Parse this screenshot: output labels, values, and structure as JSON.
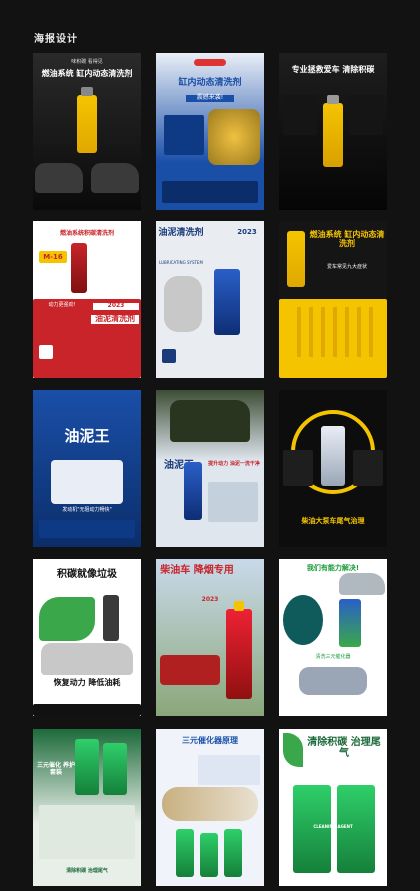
{
  "section": {
    "heading": "海报设计"
  },
  "posters": [
    {
      "title": "燃油系统 缸内动态清洗剂",
      "subtitle": "味积碳 看得见"
    },
    {
      "title": "缸内动态清洗剂",
      "subtitle": "震撼来袭!"
    },
    {
      "title": "专业拯救爱车 清除积碳",
      "subtitle": ""
    },
    {
      "title": "燃油系统积碳清洗剂",
      "subtitle": "油泥清洗剂",
      "badge": "M-16",
      "year": "2023",
      "extra": "动力更强劲!"
    },
    {
      "title": "油泥清洗剂",
      "subtitle": "LUBRICATING SYSTEM",
      "year": "2023"
    },
    {
      "title": "燃油系统 缸内动态清洗剂",
      "subtitle": "爱车常见九大症状"
    },
    {
      "title": "油泥王",
      "subtitle": "发动机\"无阻动力畅快\""
    },
    {
      "title": "油泥王",
      "subtitle": "提升动力 油泥一洗干净"
    },
    {
      "title": "柴油大泵车尾气治理",
      "subtitle": ""
    },
    {
      "title": "积碳就像垃圾",
      "subtitle": "恢复动力 降低油耗"
    },
    {
      "title": "柴油车 降烟专用",
      "subtitle": "",
      "year": "2023"
    },
    {
      "title": "我们有能力解决!",
      "subtitle": "清洗三元催化器"
    },
    {
      "title": "三元催化 养护套装",
      "subtitle": "清除积碳 治理尾气"
    },
    {
      "title": "三元催化器原理",
      "subtitle": ""
    },
    {
      "title": "清除积碳 治理尾气",
      "subtitle": "CLEANING AGENT"
    }
  ],
  "colors": {
    "page_bg": "#121212",
    "yellow": "#f5c400",
    "blue": "#1a4fa8",
    "green": "#3aa84a",
    "red": "#c8242a"
  }
}
